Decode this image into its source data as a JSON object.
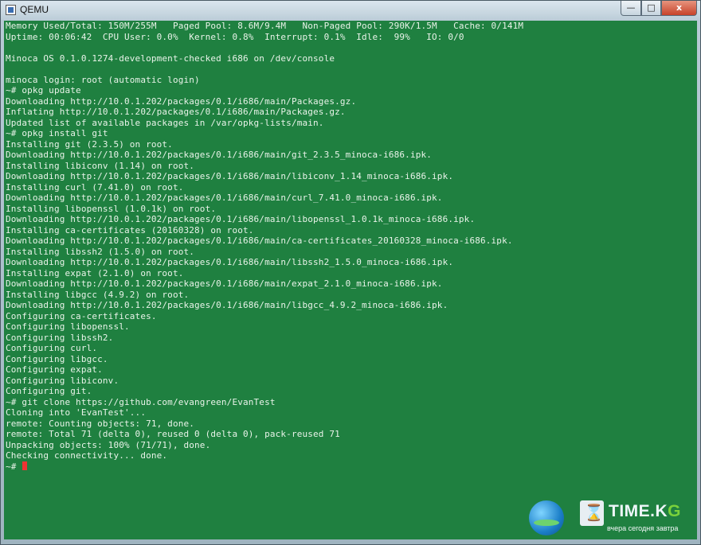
{
  "window": {
    "title": "QEMU",
    "controls": {
      "minimize": "—",
      "maximize": "□",
      "close": "x"
    }
  },
  "console": {
    "lines": [
      "Memory Used/Total: 150M/255M   Paged Pool: 8.6M/9.4M   Non-Paged Pool: 290K/1.5M   Cache: 0/141M",
      "Uptime: 00:06:42  CPU User: 0.0%  Kernel: 0.8%  Interrupt: 0.1%  Idle:  99%   IO: 0/0",
      "",
      "Minoca OS 0.1.0.1274-development-checked i686 on /dev/console",
      "",
      "minoca login: root (automatic login)",
      "~# opkg update",
      "Downloading http://10.0.1.202/packages/0.1/i686/main/Packages.gz.",
      "Inflating http://10.0.1.202/packages/0.1/i686/main/Packages.gz.",
      "Updated list of available packages in /var/opkg-lists/main.",
      "~# opkg install git",
      "Installing git (2.3.5) on root.",
      "Downloading http://10.0.1.202/packages/0.1/i686/main/git_2.3.5_minoca-i686.ipk.",
      "Installing libiconv (1.14) on root.",
      "Downloading http://10.0.1.202/packages/0.1/i686/main/libiconv_1.14_minoca-i686.ipk.",
      "Installing curl (7.41.0) on root.",
      "Downloading http://10.0.1.202/packages/0.1/i686/main/curl_7.41.0_minoca-i686.ipk.",
      "Installing libopenssl (1.0.1k) on root.",
      "Downloading http://10.0.1.202/packages/0.1/i686/main/libopenssl_1.0.1k_minoca-i686.ipk.",
      "Installing ca-certificates (20160328) on root.",
      "Downloading http://10.0.1.202/packages/0.1/i686/main/ca-certificates_20160328_minoca-i686.ipk.",
      "Installing libssh2 (1.5.0) on root.",
      "Downloading http://10.0.1.202/packages/0.1/i686/main/libssh2_1.5.0_minoca-i686.ipk.",
      "Installing expat (2.1.0) on root.",
      "Downloading http://10.0.1.202/packages/0.1/i686/main/expat_2.1.0_minoca-i686.ipk.",
      "Installing libgcc (4.9.2) on root.",
      "Downloading http://10.0.1.202/packages/0.1/i686/main/libgcc_4.9.2_minoca-i686.ipk.",
      "Configuring ca-certificates.",
      "Configuring libopenssl.",
      "Configuring libssh2.",
      "Configuring curl.",
      "Configuring libgcc.",
      "Configuring expat.",
      "Configuring libiconv.",
      "Configuring git.",
      "~# git clone https://github.com/evangreen/EvanTest",
      "Cloning into 'EvanTest'...",
      "remote: Counting objects: 71, done.",
      "remote: Total 71 (delta 0), reused 0 (delta 0), pack-reused 71",
      "Unpacking objects: 100% (71/71), done.",
      "Checking connectivity... done."
    ],
    "prompt": "~# ",
    "colors": {
      "background": "#1f8040",
      "text": "#e9f3e9",
      "cursor": "#ee3333"
    }
  },
  "watermark": {
    "brand_main": "TIME.K",
    "brand_accent": "G",
    "tagline": "вчера сегодня завтра"
  }
}
